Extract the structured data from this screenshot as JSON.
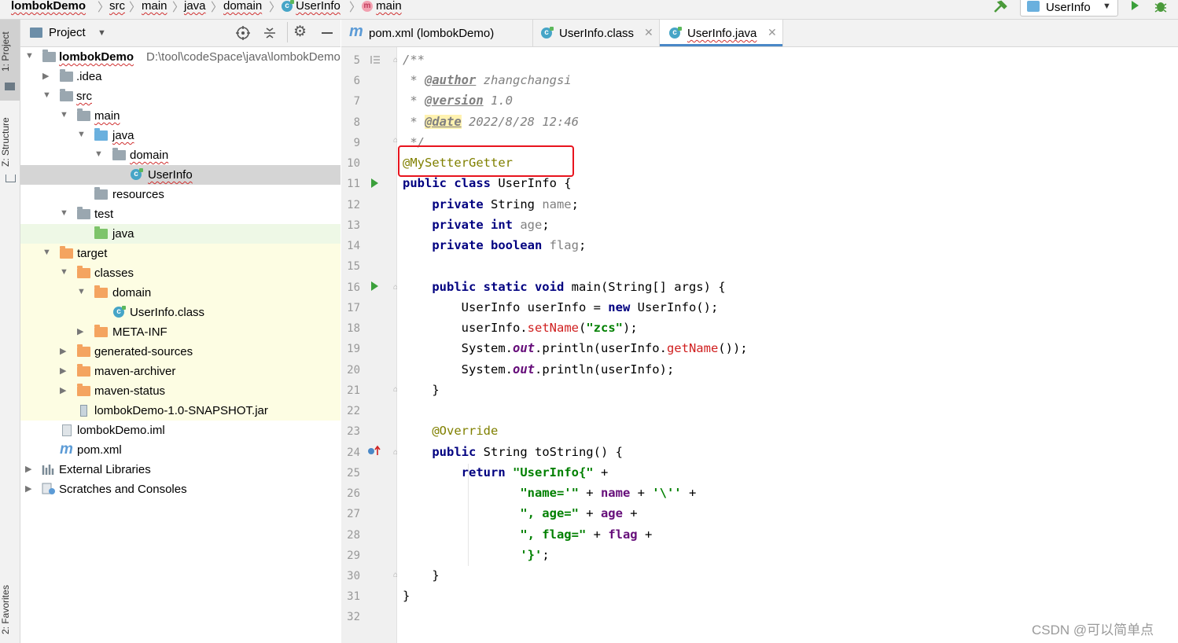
{
  "navbar": {
    "crumbs": [
      "lombokDemo",
      "src",
      "main",
      "java",
      "domain",
      "UserInfo",
      "main"
    ],
    "run_config": "UserInfo"
  },
  "sidebar": {
    "tabs": [
      "1: Project",
      "Z: Structure",
      "2: Favorites"
    ]
  },
  "project": {
    "header_label": "Project",
    "root_name": "lombokDemo",
    "root_path": "D:\\tool\\codeSpace\\java\\lombokDemo",
    "items": [
      {
        "label": ".idea"
      },
      {
        "label": "src"
      },
      {
        "label": "main"
      },
      {
        "label": "java"
      },
      {
        "label": "domain"
      },
      {
        "label": "UserInfo"
      },
      {
        "label": "resources"
      },
      {
        "label": "test"
      },
      {
        "label": "java"
      },
      {
        "label": "target"
      },
      {
        "label": "classes"
      },
      {
        "label": "domain"
      },
      {
        "label": "UserInfo.class"
      },
      {
        "label": "META-INF"
      },
      {
        "label": "generated-sources"
      },
      {
        "label": "maven-archiver"
      },
      {
        "label": "maven-status"
      },
      {
        "label": "lombokDemo-1.0-SNAPSHOT.jar"
      },
      {
        "label": "lombokDemo.iml"
      },
      {
        "label": "pom.xml"
      },
      {
        "label": "External Libraries"
      },
      {
        "label": "Scratches and Consoles"
      }
    ]
  },
  "editor": {
    "tabs": [
      "pom.xml (lombokDemo)",
      "UserInfo.class",
      "UserInfo.java"
    ],
    "active_tab": "UserInfo.java",
    "line_numbers": [
      "5",
      "6",
      "7",
      "8",
      "9",
      "10",
      "11",
      "12",
      "13",
      "14",
      "15",
      "16",
      "17",
      "18",
      "19",
      "20",
      "21",
      "22",
      "23",
      "24",
      "25",
      "26",
      "27",
      "28",
      "29",
      "30",
      "31",
      "32"
    ],
    "code": {
      "c5": "/**",
      "c6_tag": "@author",
      "c6_val": " zhangchangsi",
      "c7_tag": "@version",
      "c7_val": " 1.0",
      "c8_tag": "@date",
      "c8_val": " 2022/8/28 12:46",
      "c9": " */",
      "c10": "@MySetterGetter",
      "c11_kw": "public class",
      "c11_rest": " UserInfo {",
      "c12_kw": "private",
      "c12_type": " String ",
      "c12_f": "name",
      "c12_end": ";",
      "c13_kw": "private int",
      "c13_f": " age",
      "c13_end": ";",
      "c14_kw": "private boolean",
      "c14_f": " flag",
      "c14_end": ";",
      "c16_kw": "public static void",
      "c16_rest": " main(String[] args) {",
      "c17_a": "UserInfo userInfo = ",
      "c17_kw": "new",
      "c17_b": " UserInfo();",
      "c18_a": "userInfo.",
      "c18_m": "setName",
      "c18_b": "(",
      "c18_s": "\"zcs\"",
      "c18_c": ");",
      "c19_a": "System.",
      "c19_o": "out",
      "c19_b": ".println(userInfo.",
      "c19_m": "getName",
      "c19_c": "());",
      "c20_a": "System.",
      "c20_o": "out",
      "c20_b": ".println(userInfo);",
      "c21": "}",
      "c23": "@Override",
      "c24_kw": "public",
      "c24_rest": " String toString() {",
      "c25_kw": "return",
      "c25_s": " \"UserInfo{\"",
      "c25_p": " +",
      "c26_s": "\"name='\"",
      "c26_a": " + ",
      "c26_f": "name",
      "c26_b": " + ",
      "c26_s2": "'\\''",
      "c26_c": " +",
      "c27_s": "\", age=\"",
      "c27_a": " + ",
      "c27_f": "age",
      "c27_b": " +",
      "c28_s": "\", flag=\"",
      "c28_a": " + ",
      "c28_f": "flag",
      "c28_b": " +",
      "c29_s": "'}'",
      "c29_e": ";",
      "c30": "}",
      "c31": "}"
    }
  },
  "watermark": "CSDN @可以简单点"
}
